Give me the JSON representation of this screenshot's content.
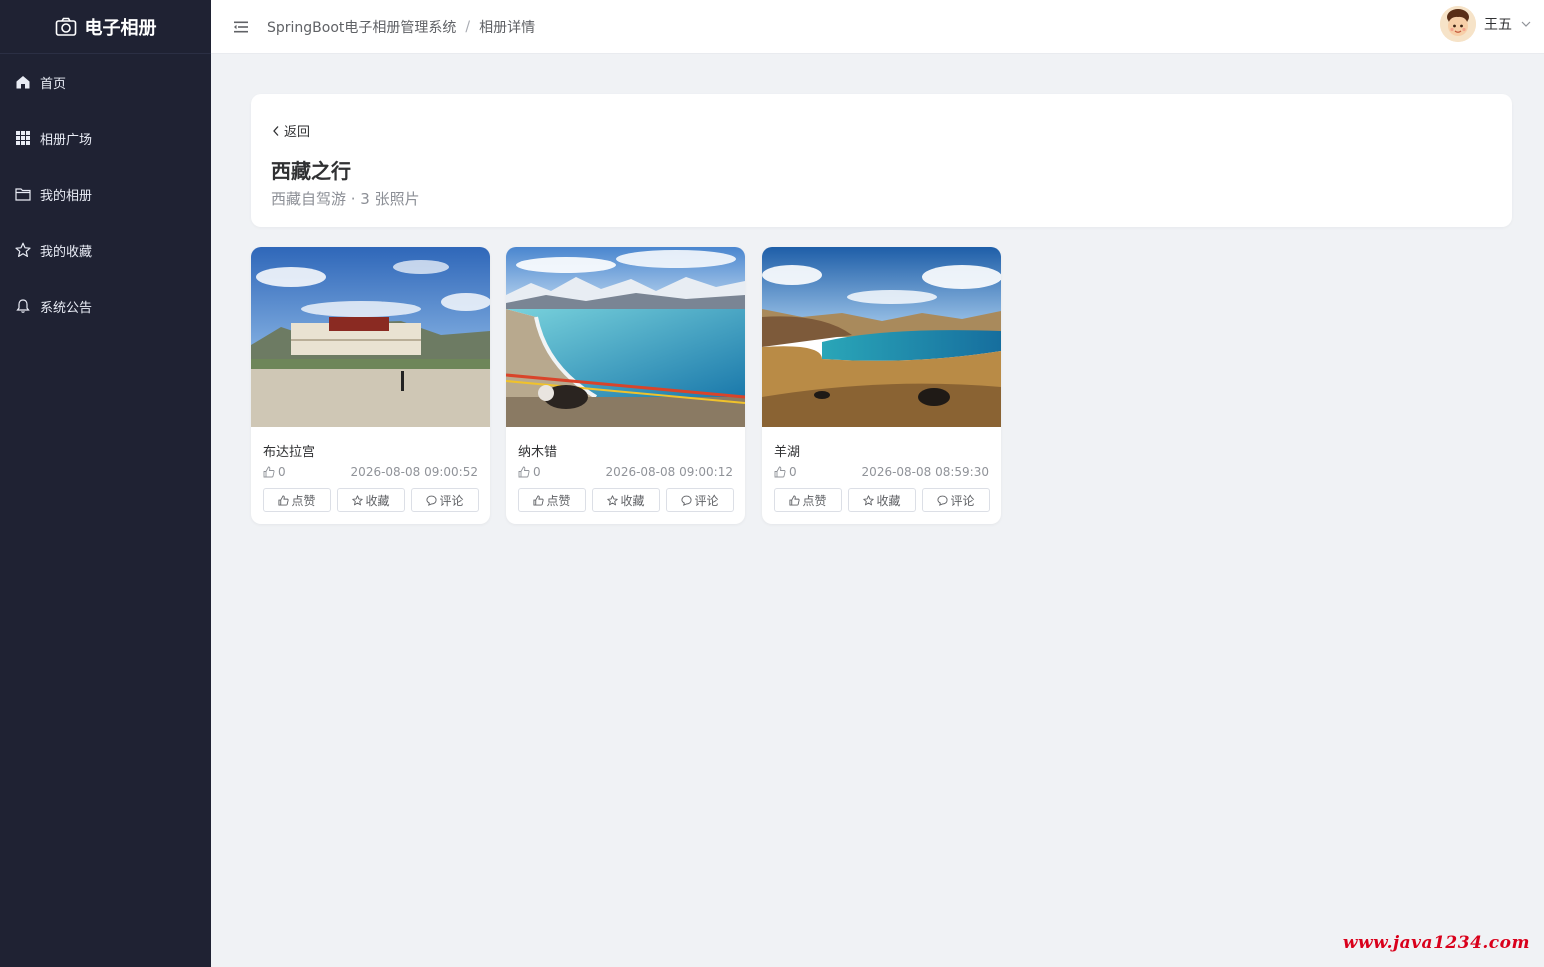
{
  "sidebar": {
    "logo_icon": "camera-icon",
    "logo_text": "电子相册",
    "items": [
      {
        "label": "首页",
        "icon": "home-icon"
      },
      {
        "label": "相册广场",
        "icon": "grid-icon"
      },
      {
        "label": "我的相册",
        "icon": "folder-icon"
      },
      {
        "label": "我的收藏",
        "icon": "star-icon"
      },
      {
        "label": "系统公告",
        "icon": "bell-icon"
      }
    ]
  },
  "header": {
    "breadcrumb": [
      "SpringBoot电子相册管理系统",
      "相册详情"
    ],
    "separator": "/",
    "user_name": "王五"
  },
  "album": {
    "back_label": "返回",
    "title": "西藏之行",
    "subtitle": "西藏自驾游 · 3 张照片"
  },
  "photos": [
    {
      "name": "布达拉宫",
      "likes": "0",
      "time": "2026-08-08 09:00:52"
    },
    {
      "name": "纳木错",
      "likes": "0",
      "time": "2026-08-08 09:00:12"
    },
    {
      "name": "羊湖",
      "likes": "0",
      "time": "2026-08-08 08:59:30"
    }
  ],
  "actions": {
    "like": "点赞",
    "favorite": "收藏",
    "comment": "评论"
  },
  "watermark": "www.java1234.com",
  "colors": {
    "sidebar_bg": "#1f2233",
    "page_bg": "#f0f2f5",
    "watermark": "#d9001b"
  }
}
